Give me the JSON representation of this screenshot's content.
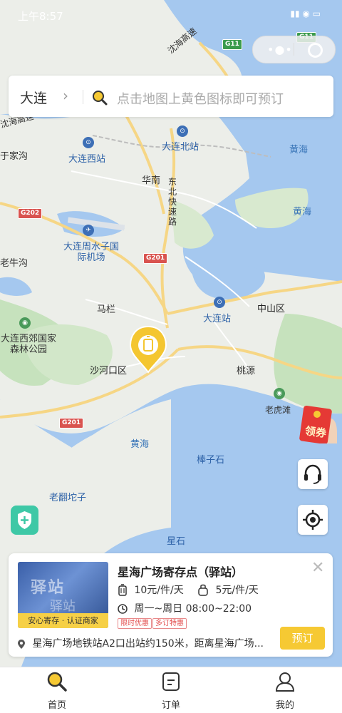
{
  "status_bar": {
    "time": "上午8:57",
    "indicators": "▮▮ ◉ ▭"
  },
  "capsule": {
    "more_icon": "more-dots-icon",
    "close_icon": "target-icon"
  },
  "search": {
    "city": "大连",
    "placeholder": "点击地图上黄色图标即可预订"
  },
  "map": {
    "highways": [
      "G11",
      "G11",
      "G202",
      "G201",
      "G201"
    ],
    "labels": {
      "shenhai": "沈海高速",
      "jiagou": "于家沟",
      "dalian_west": "大连西站",
      "dalian_north": "大连北站",
      "huanan": "华南",
      "dongbei": "东北快速路",
      "huanghai1": "黄海",
      "huanghai2": "黄海",
      "airport": "大连周水子国际机场",
      "laoniu": "老牛沟",
      "malan": "马栏",
      "dalian_station": "大连站",
      "zhongshan": "中山区",
      "west_park": "大连西郊国家森林公园",
      "shahekou": "沙河口区",
      "taoyuan": "桃源",
      "laohutan": "老虎滩",
      "huanghai3": "黄海",
      "bangzishi": "棒子石",
      "laotuozi": "老翻坨子",
      "xingshi": "星石",
      "chenmafang": "沈海高速"
    }
  },
  "red_packet": {
    "label": "领券"
  },
  "card": {
    "title": "星海广场寄存点（驿站）",
    "photo_text": "驿站",
    "photo_text2": "驿站",
    "photo_tag": "安心寄存 · 认证商家",
    "price_large": "10元/件/天",
    "price_small": "5元/件/天",
    "hours": "周一~周日 08:00~22:00",
    "badges": [
      "限时优惠",
      "多订特惠"
    ],
    "address": "星海广场地铁站A2口出站约150米，距离星海广场...",
    "book_label": "预订"
  },
  "tabs": [
    {
      "label": "首页",
      "icon": "search-icon"
    },
    {
      "label": "订单",
      "icon": "order-icon"
    },
    {
      "label": "我的",
      "icon": "user-icon"
    }
  ]
}
